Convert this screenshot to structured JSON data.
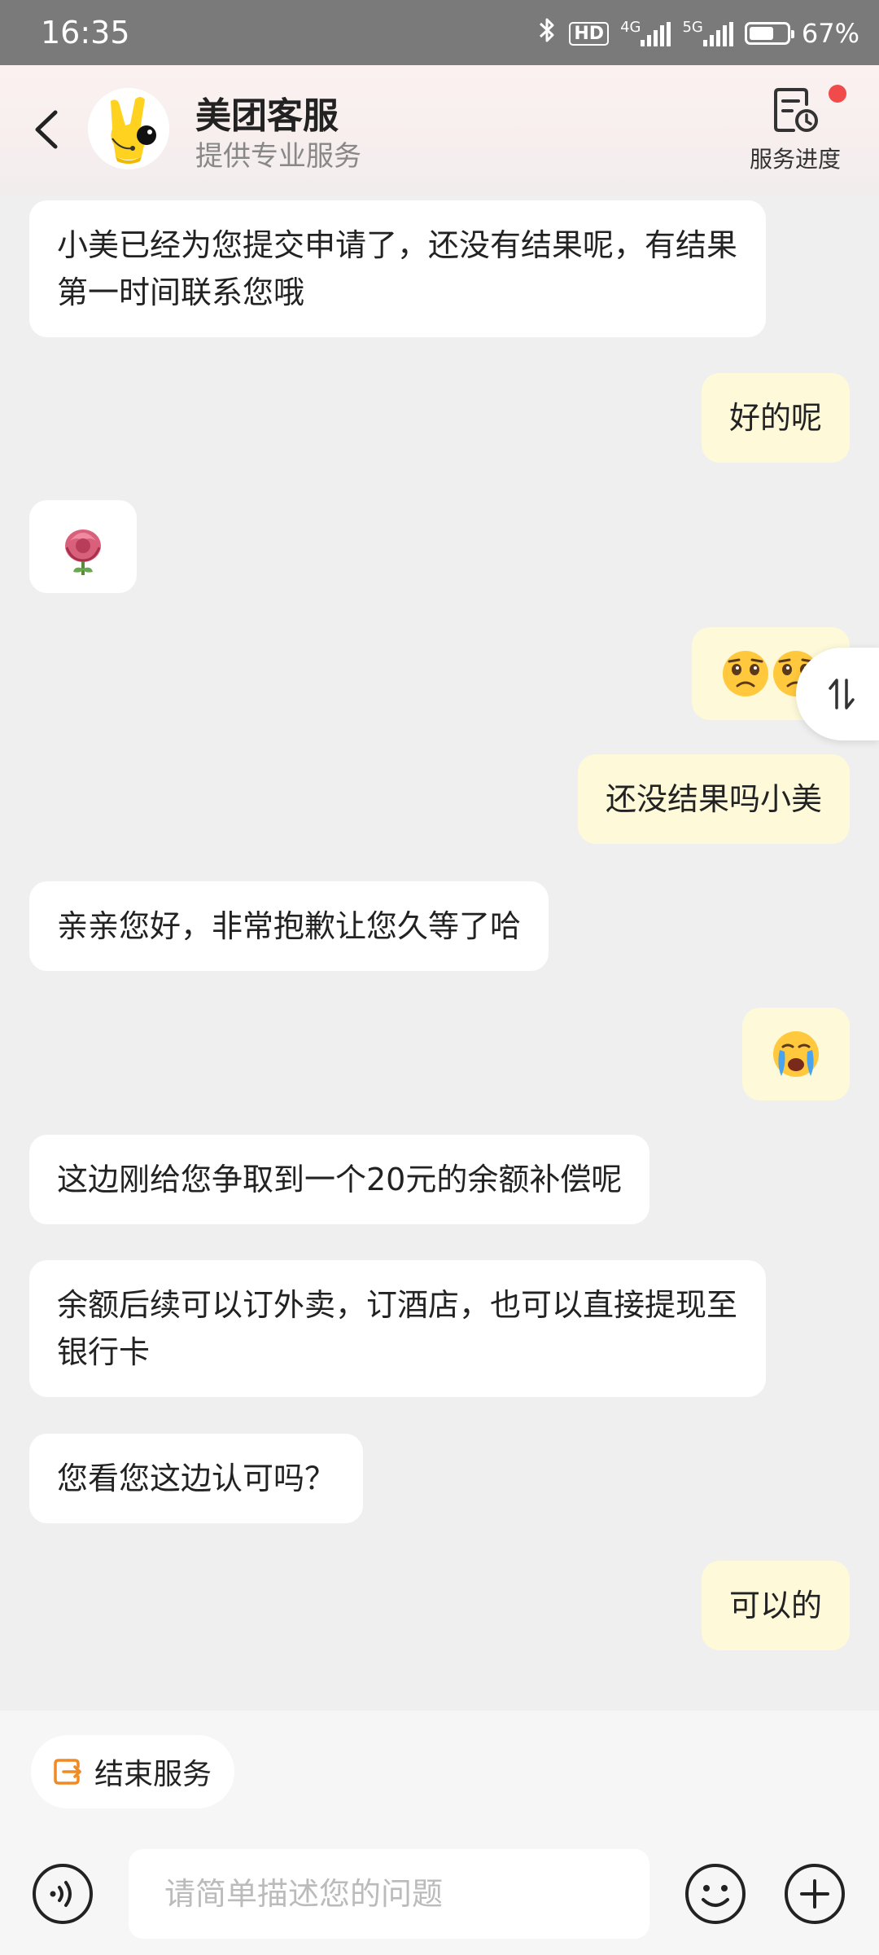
{
  "status_bar": {
    "time": "16:35",
    "hd": "HD",
    "net_4g": "4G",
    "net_5g": "5G",
    "battery_pct": "67%",
    "battery_level": 0.67
  },
  "header": {
    "title": "美团客服",
    "subtitle": "提供专业服务",
    "progress_label": "服务进度",
    "accent": "#f04a4a"
  },
  "messages": [
    {
      "from": "agent",
      "text": "小美已经为您提交申请了，还没有结果呢，有结果第一时间联系您哦"
    },
    {
      "from": "me",
      "text": "好的呢"
    },
    {
      "from": "agent",
      "sticker": "rose-sticker"
    },
    {
      "from": "me",
      "sticker": "pleading-face-emoji x2"
    },
    {
      "from": "me",
      "text": "还没结果吗小美"
    },
    {
      "from": "agent",
      "text": "亲亲您好，非常抱歉让您久等了哈"
    },
    {
      "from": "me",
      "sticker": "loudly-crying-face-emoji"
    },
    {
      "from": "agent",
      "text": "这边刚给您争取到一个20元的余额补偿呢"
    },
    {
      "from": "agent",
      "text": "余额后续可以订外卖，订酒店，也可以直接提现至银行卡"
    },
    {
      "from": "agent",
      "text": "您看您这边认可吗？"
    },
    {
      "from": "me",
      "text": "可以的"
    }
  ],
  "footer": {
    "end_service_label": "结束服务",
    "input_placeholder": "请简单描述您的问题",
    "accent": "#f08a24"
  },
  "colors": {
    "agent_bubble": "#ffffff",
    "my_bubble": "#fdf9d9",
    "background": "#efefef"
  }
}
